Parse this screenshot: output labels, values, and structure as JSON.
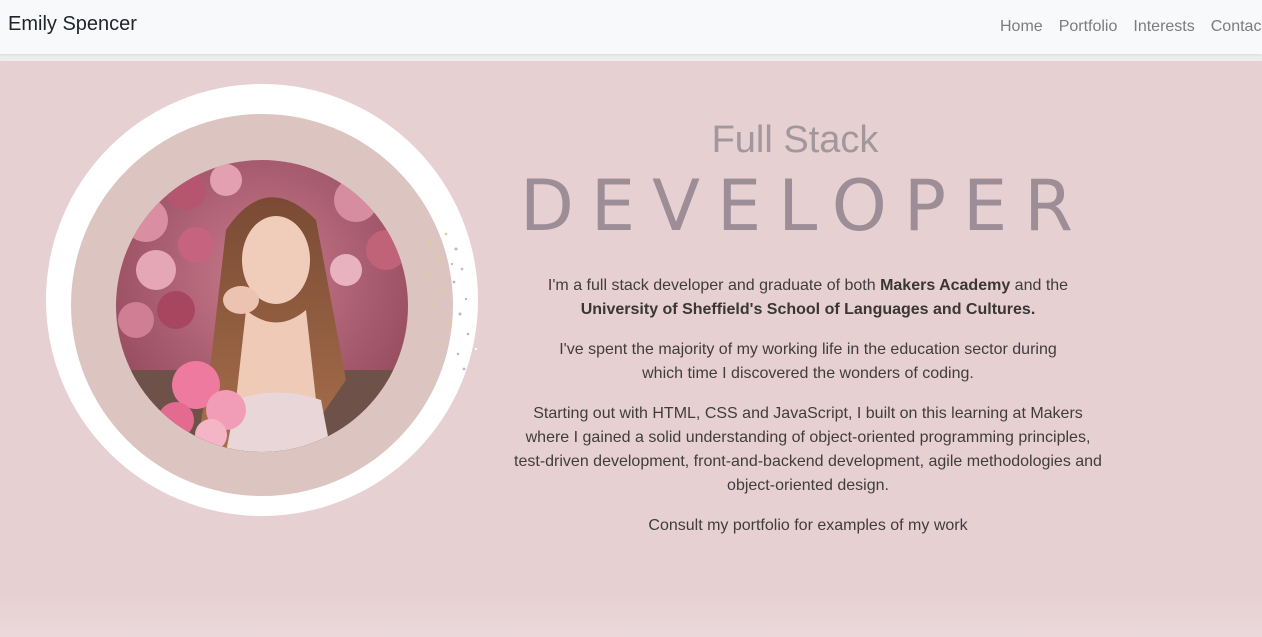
{
  "navbar": {
    "brand": "Emily Spencer",
    "links": [
      "Home",
      "Portfolio",
      "Interests",
      "Contact"
    ]
  },
  "hero": {
    "subtitle": "Full Stack",
    "title": "DEVELOPER",
    "p1_a": "I'm a full stack developer and graduate of both ",
    "p1_b1": "Makers Academy",
    "p1_c": " and the ",
    "p1_b2": "University of Sheffield's School of Languages and Cultures.",
    "p2": "I've spent the majority of my working life in the education sector during which time I discovered the wonders of coding.",
    "p3": "Starting out with HTML, CSS and JavaScript, I built on this learning at Makers where I gained a solid understanding of object-oriented programming principles, test-driven development, front-and-backend development, agile methodologies and object-oriented design.",
    "p4": "Consult my portfolio for examples of my work"
  },
  "colors": {
    "background": "#e7d0d2",
    "navbar": "#f8f9fa",
    "accent": "#9c8d97"
  }
}
